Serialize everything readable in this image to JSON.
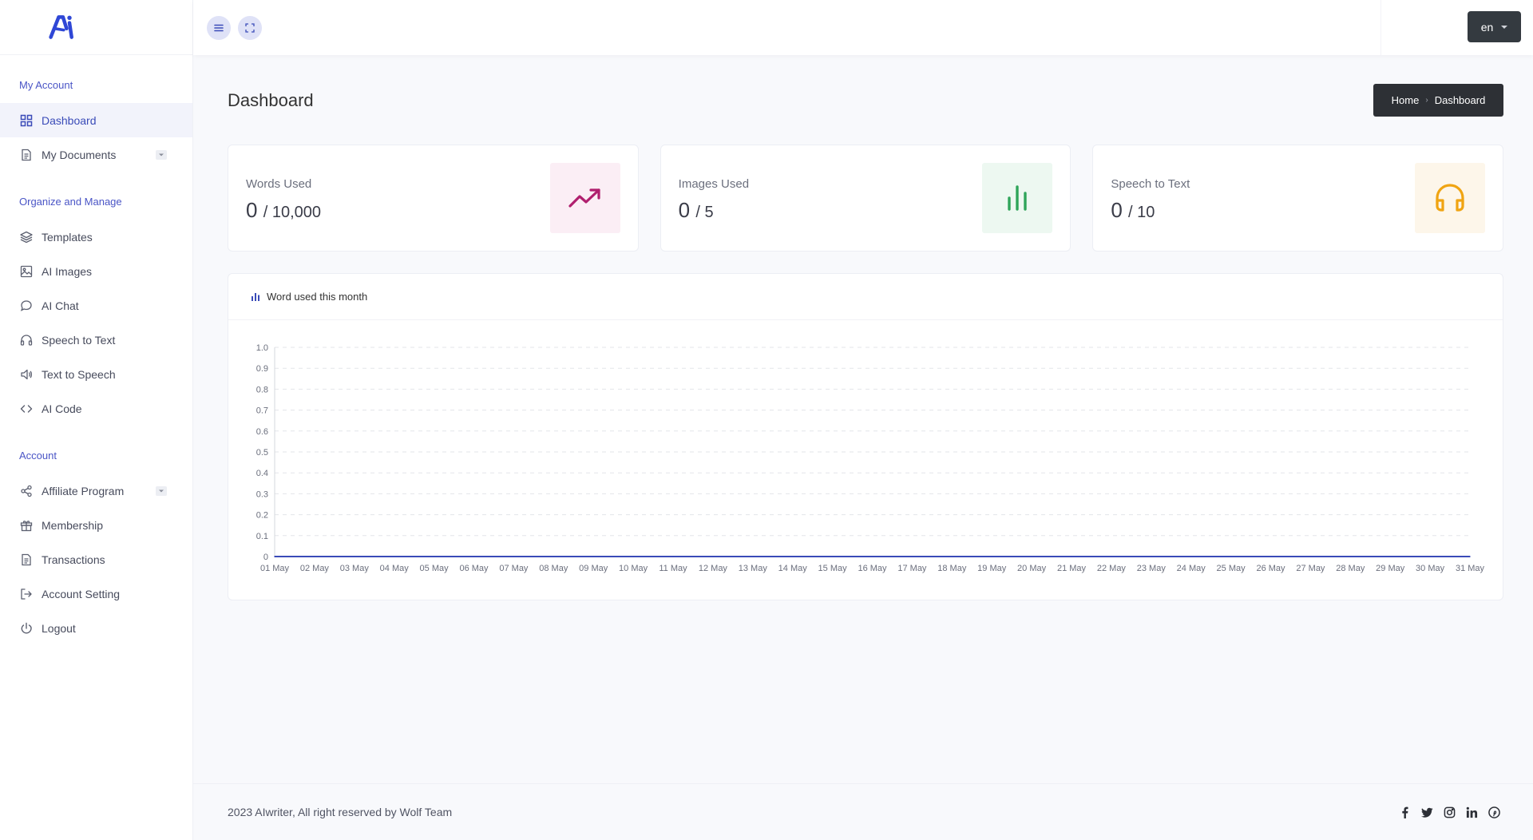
{
  "brand": {
    "logo_text": "Ai",
    "accent": "#3a4bd8"
  },
  "sidebar": {
    "sections": [
      {
        "title": "My Account",
        "items": [
          {
            "label": "Dashboard",
            "icon": "grid-icon",
            "active": true
          },
          {
            "label": "My Documents",
            "icon": "document-icon",
            "has_submenu": true
          }
        ]
      },
      {
        "title": "Organize and Manage",
        "items": [
          {
            "label": "Templates",
            "icon": "layers-icon"
          },
          {
            "label": "AI Images",
            "icon": "image-icon"
          },
          {
            "label": "AI Chat",
            "icon": "chat-icon"
          },
          {
            "label": "Speech to Text",
            "icon": "headphones-icon"
          },
          {
            "label": "Text to Speech",
            "icon": "speaker-icon"
          },
          {
            "label": "AI Code",
            "icon": "code-icon"
          }
        ]
      },
      {
        "title": "Account",
        "items": [
          {
            "label": "Affiliate Program",
            "icon": "share-icon",
            "has_submenu": true
          },
          {
            "label": "Membership",
            "icon": "gift-icon"
          },
          {
            "label": "Transactions",
            "icon": "receipt-icon"
          },
          {
            "label": "Account Setting",
            "icon": "logout-arrow-icon"
          },
          {
            "label": "Logout",
            "icon": "power-icon"
          }
        ]
      }
    ]
  },
  "header": {
    "language": "en"
  },
  "page": {
    "title": "Dashboard",
    "breadcrumb": {
      "home": "Home",
      "sep": "›",
      "current": "Dashboard"
    }
  },
  "cards": [
    {
      "label": "Words Used",
      "used": "0",
      "limit": "/ 10,000",
      "icon": "trending-up-icon",
      "bg": "#fbeef5",
      "color": "#b01f6e"
    },
    {
      "label": "Images Used",
      "used": "0",
      "limit": "/ 5",
      "icon": "bar-chart-icon",
      "bg": "#edf8f1",
      "color": "#2fa55a"
    },
    {
      "label": "Speech to Text",
      "used": "0",
      "limit": "/ 10",
      "icon": "headphones-icon",
      "bg": "#fdf6ea",
      "color": "#f0a412"
    }
  ],
  "chart_card": {
    "title": "Word used this month"
  },
  "chart_data": {
    "type": "line",
    "title": "Word used this month",
    "xlabel": "",
    "ylabel": "",
    "x": [
      "01 May",
      "02 May",
      "03 May",
      "04 May",
      "05 May",
      "06 May",
      "07 May",
      "08 May",
      "09 May",
      "10 May",
      "11 May",
      "12 May",
      "13 May",
      "14 May",
      "15 May",
      "16 May",
      "17 May",
      "18 May",
      "19 May",
      "20 May",
      "21 May",
      "22 May",
      "23 May",
      "24 May",
      "25 May",
      "26 May",
      "27 May",
      "28 May",
      "29 May",
      "30 May",
      "31 May"
    ],
    "series": [
      {
        "values": [
          0,
          0,
          0,
          0,
          0,
          0,
          0,
          0,
          0,
          0,
          0,
          0,
          0,
          0,
          0,
          0,
          0,
          0,
          0,
          0,
          0,
          0,
          0,
          0,
          0,
          0,
          0,
          0,
          0,
          0,
          0
        ]
      }
    ],
    "ylim": [
      0,
      1
    ],
    "yticks": [
      "0",
      "0.1",
      "0.2",
      "0.3",
      "0.4",
      "0.5",
      "0.6",
      "0.7",
      "0.8",
      "0.9",
      "1.0"
    ],
    "grid": true,
    "line_color": "#3a4bb8"
  },
  "footer": {
    "copyright": "2023 AIwriter, All right reserved by Wolf Team",
    "social": [
      "facebook-icon",
      "twitter-icon",
      "instagram-icon",
      "linkedin-icon",
      "pinterest-icon"
    ]
  }
}
